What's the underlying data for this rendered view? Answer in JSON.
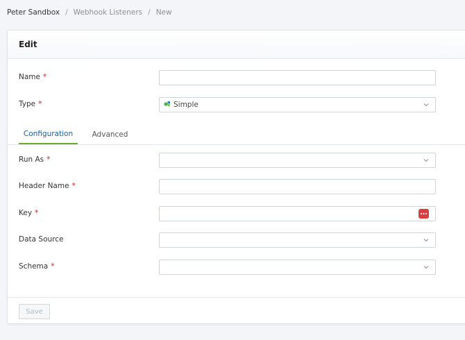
{
  "breadcrumb": {
    "items": [
      "Peter Sandbox",
      "Webhook Listeners",
      "New"
    ],
    "separator": "/"
  },
  "card": {
    "title": "Edit"
  },
  "form": {
    "name": {
      "label": "Name",
      "required_mark": "*",
      "value": ""
    },
    "type": {
      "label": "Type",
      "required_mark": "*",
      "value": "Simple",
      "icon": "simple-type-icon"
    }
  },
  "tabs": [
    {
      "label": "Configuration",
      "active": true
    },
    {
      "label": "Advanced",
      "active": false
    }
  ],
  "config": {
    "run_as": {
      "label": "Run As",
      "required_mark": "*",
      "value": ""
    },
    "header_name": {
      "label": "Header Name",
      "required_mark": "*",
      "value": ""
    },
    "key": {
      "label": "Key",
      "required_mark": "*",
      "value": "",
      "button_icon": "more-dots-icon"
    },
    "data_source": {
      "label": "Data Source",
      "value": ""
    },
    "schema": {
      "label": "Schema",
      "required_mark": "*",
      "value": ""
    }
  },
  "footer": {
    "save_label": "Save"
  },
  "colors": {
    "required": "#c62828",
    "active_tab_text": "#1a5fa8",
    "active_tab_underline": "#6aab2c",
    "key_button": "#d93f3f"
  }
}
